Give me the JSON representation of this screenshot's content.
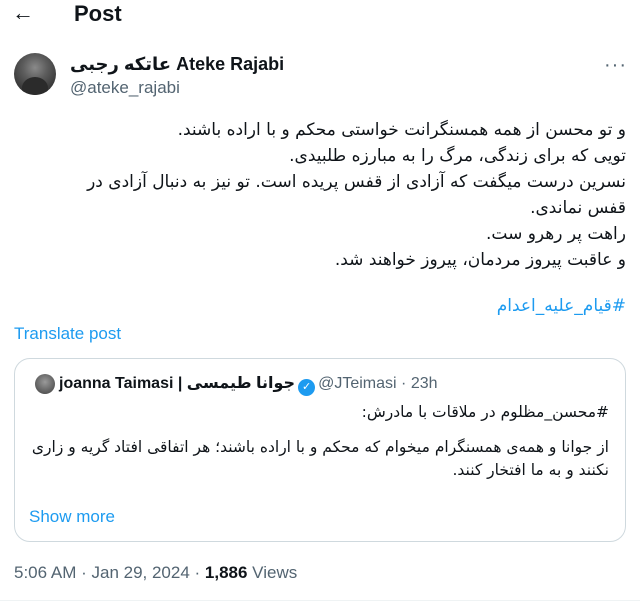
{
  "header": {
    "back_icon": "arrow-left-icon",
    "title": "Post"
  },
  "author": {
    "display_name": "عاتکه رجبی Ateke Rajabi",
    "handle": "@ateke_rajabi",
    "more_icon": "more-horizontal-icon"
  },
  "tweet": {
    "lines": [
      "و تو محسن از همه همسنگرانت خواستی محکم و با اراده باشند.",
      "تویی که برای زندگی، مرگ را به مبارزه طلبیدی.",
      "نسرین درست میگفت که آزادی از قفس پریده است. تو نیز به دنبال آزادی در قفس نماندی.",
      "راهت پر رهرو ست.",
      "و عاقبت پیروز مردمان، پیروز خواهند شد."
    ],
    "hashtag": "#قیام_علیه_اعدام",
    "translate_label": "Translate post"
  },
  "quote": {
    "name": "joanna Taimasi | جوانا طیمسی",
    "verified_icon": "verified-badge-icon",
    "handle": "@JTeimasi",
    "dot": "·",
    "time": "23h",
    "line1": "#محسن_مظلوم در ملاقات با مادرش:",
    "line2": "از جوانا و همه‌ی همسنگرام میخوام که محکم و با اراده باشند؛ هر اتفاقی افتاد گریه و زاری نکنند و به ما افتخار کنند.",
    "show_more": "Show more"
  },
  "meta": {
    "time": "5:06 AM",
    "sep1": " · ",
    "date": "Jan 29, 2024",
    "sep2": " · ",
    "views_count": "1,886",
    "views_label": " Views"
  },
  "colors": {
    "accent": "#1d9bf0",
    "text": "#0f1419",
    "muted": "#536471",
    "border": "#cfd9de"
  }
}
